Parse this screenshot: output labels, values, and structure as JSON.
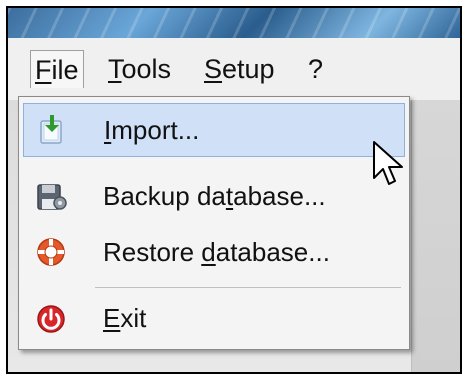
{
  "menubar": {
    "items": [
      {
        "prefix": "",
        "underline": "F",
        "suffix": "ile"
      },
      {
        "prefix": "",
        "underline": "T",
        "suffix": "ools"
      },
      {
        "prefix": "",
        "underline": "S",
        "suffix": "etup"
      },
      {
        "prefix": "?",
        "underline": "",
        "suffix": ""
      }
    ]
  },
  "file_menu": {
    "items": [
      {
        "prefix": "",
        "underline": "I",
        "suffix": "mport...",
        "icon": "import-icon"
      },
      {
        "prefix": "Backup da",
        "underline": "t",
        "suffix": "abase...",
        "icon": "backup-database-icon"
      },
      {
        "prefix": "Restore ",
        "underline": "d",
        "suffix": "atabase...",
        "icon": "restore-database-icon"
      },
      {
        "prefix": "",
        "underline": "E",
        "suffix": "xit",
        "icon": "exit-icon"
      }
    ]
  },
  "colors": {
    "highlight": "#cfe0f7",
    "accent_blue": "#3a78c2"
  }
}
